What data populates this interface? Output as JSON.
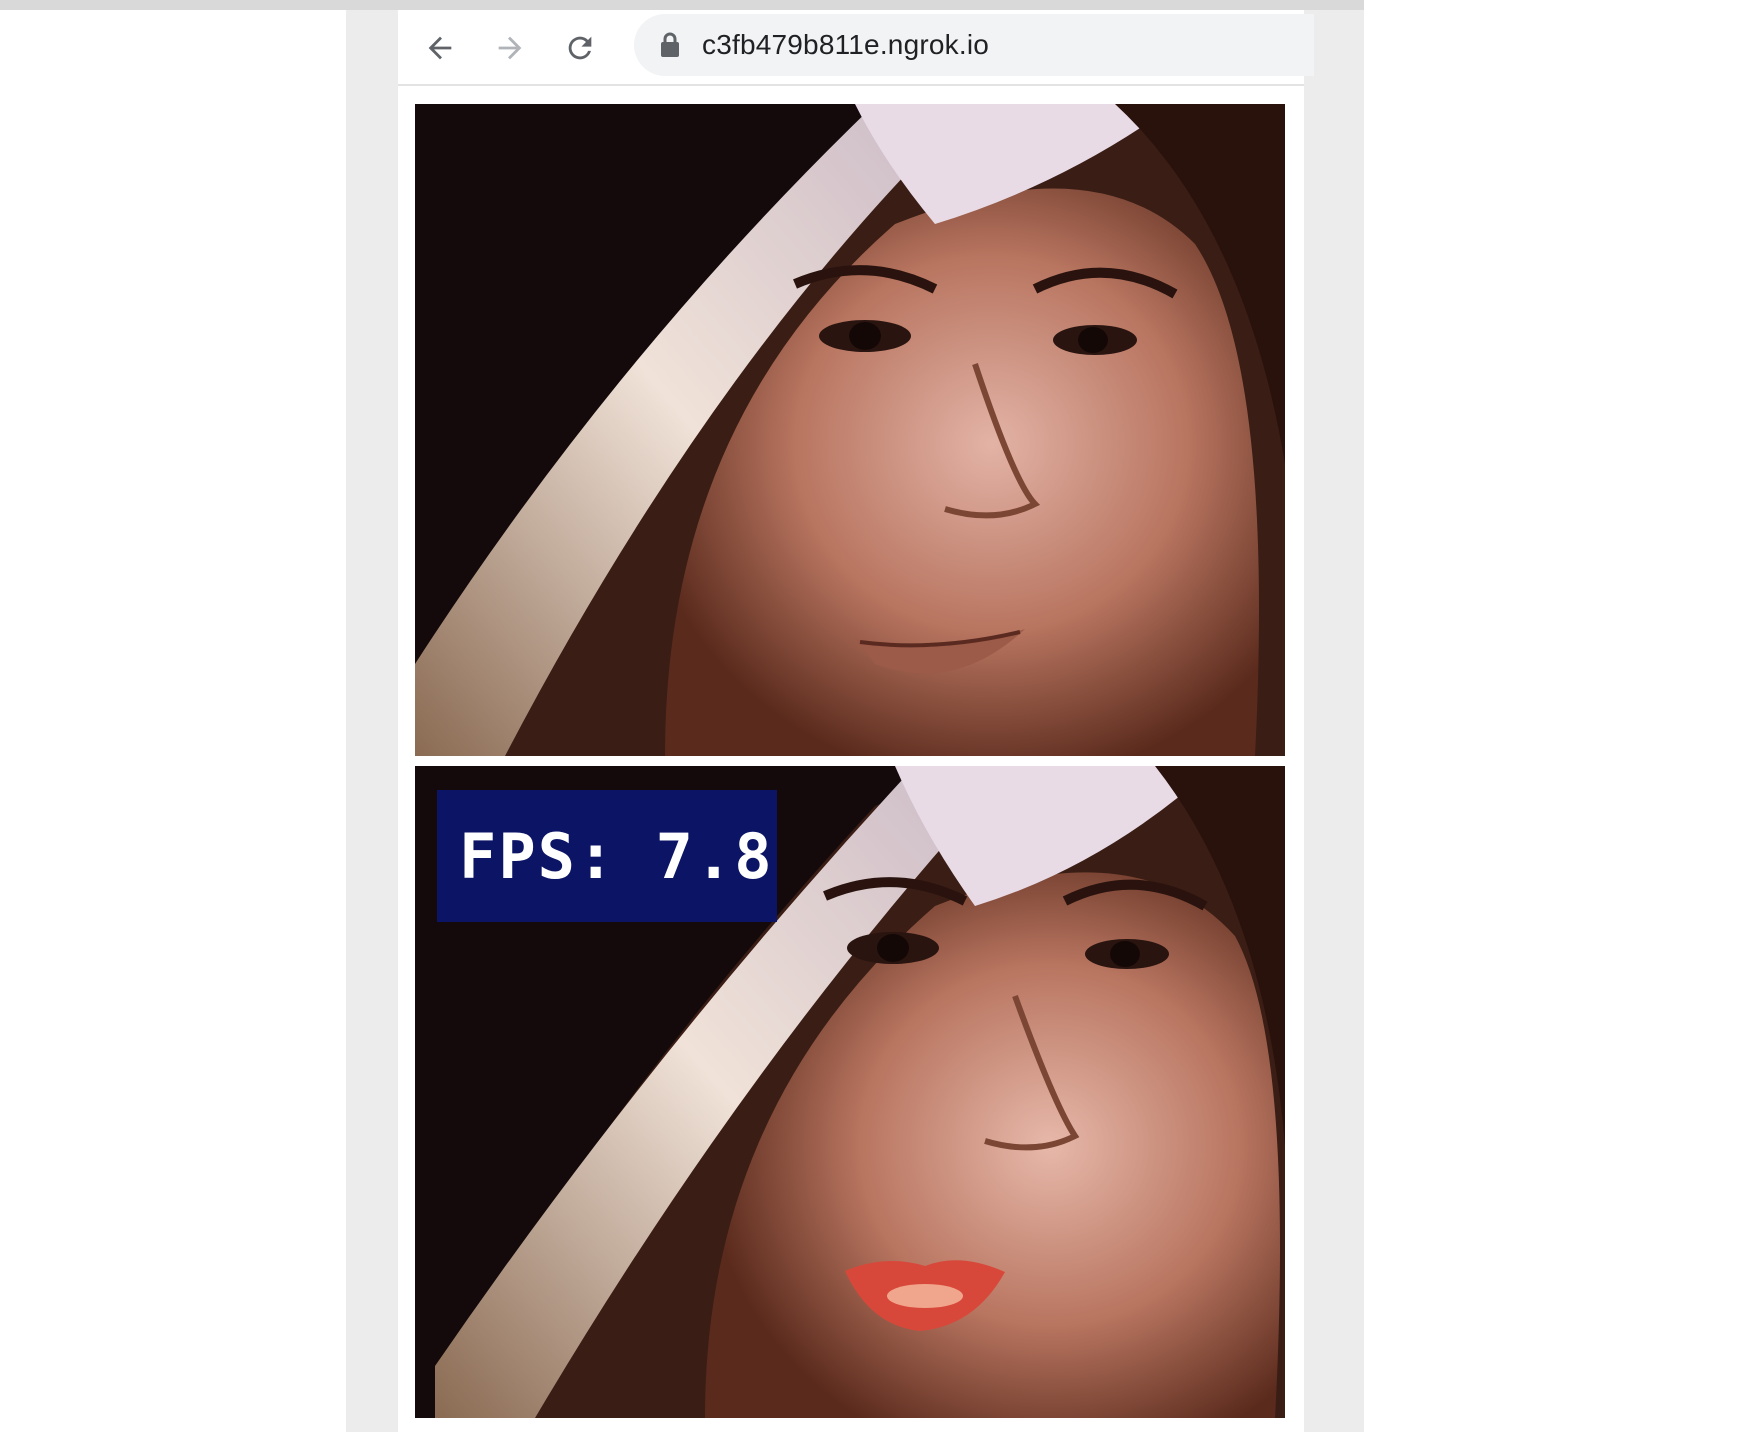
{
  "browser": {
    "url": "c3fb479b811e.ngrok.io",
    "icons": [
      "back-arrow-icon",
      "forward-arrow-icon",
      "reload-icon",
      "lock-icon"
    ]
  },
  "stream": {
    "input_frame_label": "",
    "output_overlay": {
      "fps_text": "FPS: 7.8"
    },
    "lip_color": "#d8483a",
    "overlay_color": "#0c166e"
  }
}
